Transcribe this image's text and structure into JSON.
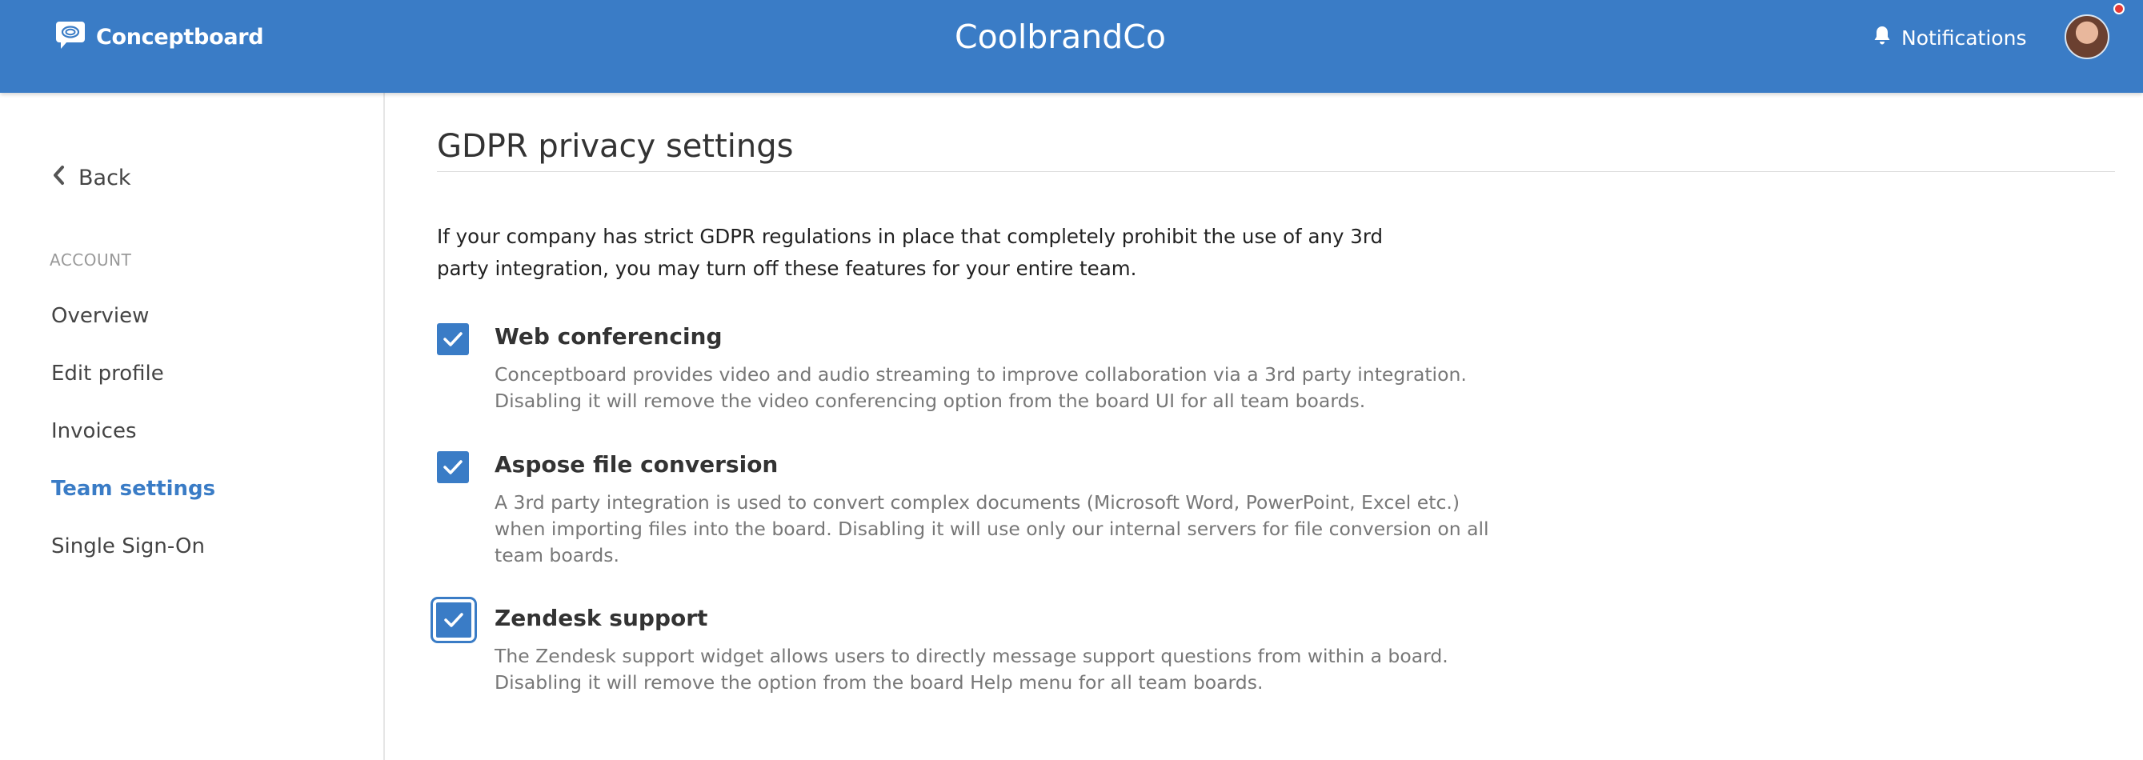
{
  "header": {
    "logo_text": "Conceptboard",
    "brand_name": "CoolbrandCo",
    "notifications_label": "Notifications",
    "accent_color": "#3a7cc6",
    "notification_dot_color": "#e53935"
  },
  "sidebar": {
    "back_label": "Back",
    "section_label": "ACCOUNT",
    "items": [
      {
        "label": "Overview",
        "active": false
      },
      {
        "label": "Edit profile",
        "active": false
      },
      {
        "label": "Invoices",
        "active": false
      },
      {
        "label": "Team settings",
        "active": true
      },
      {
        "label": "Single Sign-On",
        "active": false
      }
    ]
  },
  "main": {
    "title": "GDPR privacy settings",
    "intro": "If your company has strict GDPR regulations in place that completely prohibit the use of any 3rd party integration, you may turn off these features for your entire team.",
    "options": [
      {
        "title": "Web conferencing",
        "description": "Conceptboard provides video and audio streaming to improve collaboration via a 3rd party integration. Disabling it will remove the video conferencing option from the board UI for all team boards.",
        "checked": true
      },
      {
        "title": "Aspose file conversion",
        "description": "A 3rd party integration is used to convert complex documents (Microsoft Word, PowerPoint, Excel etc.) when importing files into the board. Disabling it will use only our internal servers for file conversion on all team boards.",
        "checked": true
      },
      {
        "title": "Zendesk support",
        "description": "The Zendesk support widget allows users to directly message support questions from within a board. Disabling it will remove the option from the board Help menu for all team boards.",
        "checked": true
      }
    ]
  },
  "icons": {
    "logo": "conceptboard-logo-icon",
    "notifications": "bell-icon",
    "back": "chevron-left-icon",
    "checkbox": "checkmark-icon",
    "user": "avatar"
  }
}
